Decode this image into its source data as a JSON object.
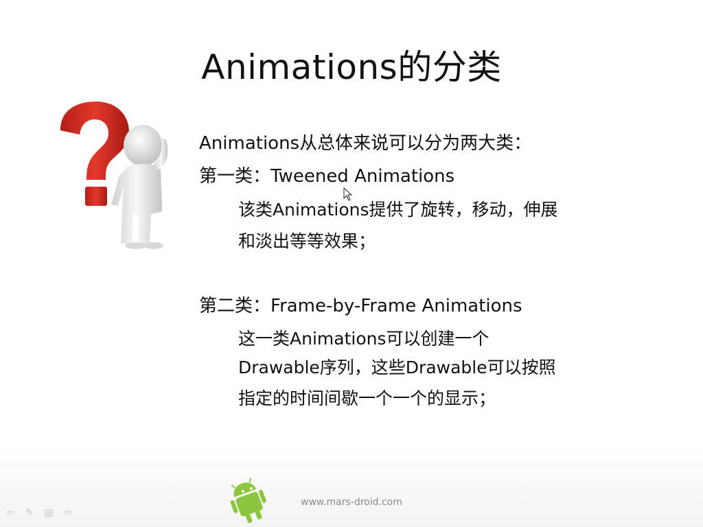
{
  "slide": {
    "title": "Animations的分类",
    "intro": "Animations从总体来说可以分为两大类：",
    "tweened": {
      "heading": "第一类：Tweened Animations",
      "desc_line1": "该类Animations提供了旋转，移动，伸展",
      "desc_line2": "和淡出等等效果；"
    },
    "frame": {
      "heading": "第二类：Frame-by-Frame Animations",
      "desc_line1": "这一类Animations可以创建一个",
      "desc_line2": "Drawable序列，这些Drawable可以按照",
      "desc_line3": "指定的时间间歇一个一个的显示；"
    }
  },
  "footer": {
    "url": "www.mars-droid.com",
    "logo_icon": "android-robot-icon"
  },
  "nav": {
    "prev_icon": "arrow-left-icon",
    "pen_icon": "pen-icon",
    "menu_icon": "menu-icon",
    "next_icon": "arrow-right-icon"
  },
  "colors": {
    "question_mark": "#d42a20",
    "android_green": "#8cc63f",
    "figure": "#e9e9e9"
  }
}
